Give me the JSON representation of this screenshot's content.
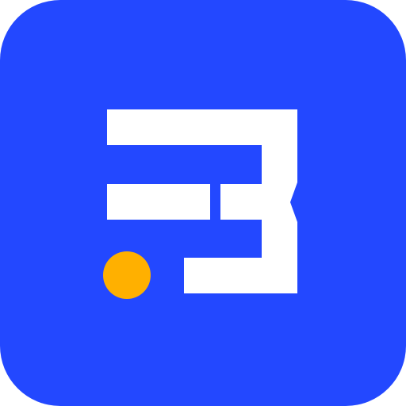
{
  "icon": {
    "name": "app-logo-icon",
    "colors": {
      "background": "#2348FF",
      "glyph": "#FFFFFF",
      "dot": "#FFB000"
    }
  }
}
